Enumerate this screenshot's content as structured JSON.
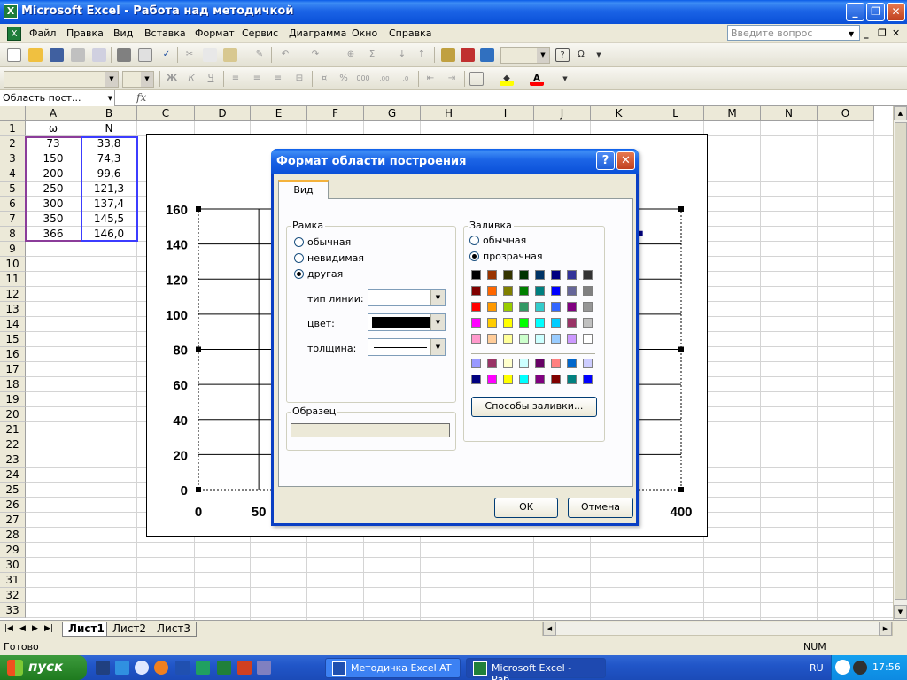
{
  "window": {
    "title": "Microsoft Excel - Работа над методичкой",
    "minimize": "_",
    "restore": "❐",
    "close": "✕"
  },
  "menu": {
    "items": [
      "Файл",
      "Правка",
      "Вид",
      "Вставка",
      "Формат",
      "Сервис",
      "Диаграмма",
      "Окно",
      "Справка"
    ],
    "help_placeholder": "Введите вопрос"
  },
  "formula_bar": {
    "name_box": "Область пост...",
    "fx": "fx"
  },
  "grid": {
    "columns": [
      "A",
      "B",
      "C",
      "D",
      "E",
      "F",
      "G",
      "H",
      "I",
      "J",
      "K",
      "L",
      "M",
      "N",
      "O"
    ],
    "rows": [
      "1",
      "2",
      "3",
      "4",
      "5",
      "6",
      "7",
      "8",
      "9",
      "10",
      "11",
      "12",
      "13",
      "14",
      "15",
      "16",
      "17",
      "18",
      "19",
      "20",
      "21",
      "22",
      "23",
      "24",
      "25",
      "26",
      "27",
      "28",
      "29",
      "30",
      "31",
      "32",
      "33"
    ],
    "col_a": [
      "ω",
      "73",
      "150",
      "200",
      "250",
      "300",
      "350",
      "366"
    ],
    "col_b": [
      "N",
      "33,8",
      "74,3",
      "99,6",
      "121,3",
      "137,4",
      "145,5",
      "146,0"
    ]
  },
  "chart_data": {
    "type": "line",
    "title": "",
    "xlabel": "",
    "ylabel": "",
    "ylim": [
      0,
      160
    ],
    "xlim": [
      0,
      400
    ],
    "y_ticks": [
      "0",
      "20",
      "40",
      "60",
      "80",
      "100",
      "120",
      "140",
      "160"
    ],
    "x_ticks_visible": [
      "0",
      "50",
      "400"
    ],
    "x": [
      73,
      150,
      200,
      250,
      300,
      350,
      366
    ],
    "series": [
      {
        "values": [
          33.8,
          74.3,
          99.6,
          121.3,
          137.4,
          145.5,
          146.0
        ]
      }
    ]
  },
  "dialog": {
    "title": "Формат области построения",
    "help_btn": "?",
    "close_btn": "✕",
    "tab": "Вид",
    "border_group": "Рамка",
    "border_options": [
      "обычная",
      "невидимая",
      "другая"
    ],
    "border_selected": 2,
    "line_type_label": "тип линии:",
    "color_label": "цвет:",
    "thickness_label": "толщина:",
    "sample_group": "Образец",
    "fill_group": "Заливка",
    "fill_options": [
      "обычная",
      "прозрачная"
    ],
    "fill_selected": 1,
    "fill_effects_btn": "Способы заливки...",
    "ok_btn": "OK",
    "cancel_btn": "Отмена",
    "palette_main": [
      "#000000",
      "#993300",
      "#333300",
      "#003300",
      "#003366",
      "#000080",
      "#333399",
      "#333333",
      "#800000",
      "#FF6600",
      "#808000",
      "#008000",
      "#008080",
      "#0000FF",
      "#666699",
      "#808080",
      "#FF0000",
      "#FF9900",
      "#99CC00",
      "#339966",
      "#33CCCC",
      "#3366FF",
      "#800080",
      "#969696",
      "#FF00FF",
      "#FFCC00",
      "#FFFF00",
      "#00FF00",
      "#00FFFF",
      "#00CCFF",
      "#993366",
      "#C0C0C0",
      "#FF99CC",
      "#FFCC99",
      "#FFFF99",
      "#CCFFCC",
      "#CCFFFF",
      "#99CCFF",
      "#CC99FF",
      "#FFFFFF"
    ],
    "palette_chart": [
      "#9999FF",
      "#993366",
      "#FFFFCC",
      "#CCFFFF",
      "#660066",
      "#FF8080",
      "#0066CC",
      "#CCCCFF",
      "#000080",
      "#FF00FF",
      "#FFFF00",
      "#00FFFF",
      "#800080",
      "#800000",
      "#008080",
      "#0000FF"
    ]
  },
  "sheets": {
    "tabs": [
      "Лист1",
      "Лист2",
      "Лист3"
    ],
    "active": 0
  },
  "status": {
    "ready": "Готово",
    "num": "NUM"
  },
  "taskbar": {
    "start": "пуск",
    "tasks": [
      "Методичка Excel AT ...",
      "Microsoft Excel - Раб..."
    ],
    "lang": "RU",
    "clock": "17:56"
  }
}
